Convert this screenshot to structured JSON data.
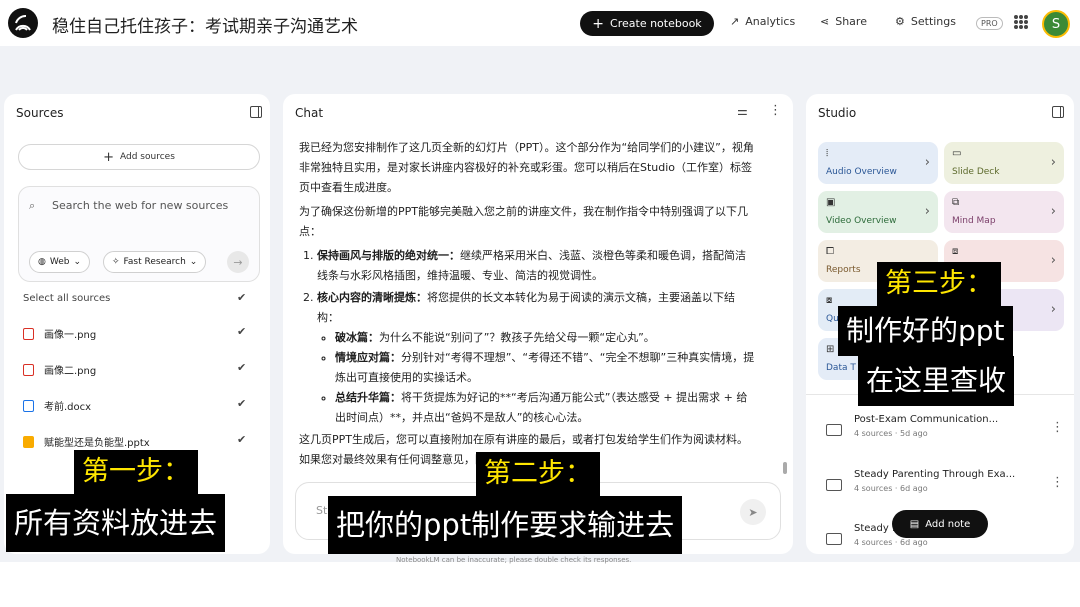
{
  "header": {
    "notebook_title": "稳住自己托住孩子：考试期亲子沟通艺术",
    "create_notebook": "Create notebook",
    "analytics": "Analytics",
    "share": "Share",
    "settings": "Settings",
    "pro": "PRO",
    "avatar_letter": "S"
  },
  "sources": {
    "title": "Sources",
    "add_sources": "Add sources",
    "search_placeholder": "Search the web for new sources",
    "web_chip": "Web",
    "research_chip": "Fast Research",
    "select_all": "Select all sources",
    "items": [
      {
        "name": "画像一.png",
        "icon": "image-icon",
        "color": "#d93025"
      },
      {
        "name": "画像二.png",
        "icon": "image-icon",
        "color": "#d93025"
      },
      {
        "name": "考前.docx",
        "icon": "doc-icon",
        "color": "#1a73e8"
      },
      {
        "name": "赋能型还是负能型.pptx",
        "icon": "slides-icon",
        "color": "#f9ab00"
      }
    ]
  },
  "chat": {
    "title": "Chat",
    "p1": "我已经为您安排制作了这几页全新的幻灯片（PPT）。这个部分作为“给同学们的小建议”，视角非常独特且实用，是对家长讲座内容极好的补充或彩蛋。您可以稍后在Studio（工作室）标签页中查看生成进度。",
    "p2": "为了确保这份新增的PPT能够完美融入您之前的讲座文件，我在制作指令中特别强调了以下几点：",
    "li1_bold": "保持画风与排版的绝对统一：",
    "li1_text": "继续严格采用米白、浅蓝、淡橙色等柔和暖色调，搭配简洁线条与水彩风格插图，维持温暖、专业、简洁的视觉调性。",
    "li2_bold": "核心内容的清晰提炼：",
    "li2_text": "将您提供的长文本转化为易于阅读的演示文稿，主要涵盖以下结构：",
    "sub1_bold": "破冰篇：",
    "sub1_text": "为什么不能说“别问了”？教孩子先给父母一颗“定心丸”。",
    "sub2_bold": "情境应对篇：",
    "sub2_text": "分别针对“考得不理想”、“考得还不错”、“完全不想聊”三种真实情境，提炼出可直接使用的实操话术。",
    "sub3_bold": "总结升华篇：",
    "sub3_text": "将干货提炼为好记的**“考后沟通万能公式”（表达感受 + 提出需求 + 给出时间点）**，并点出“爸妈不是敌人”的核心心法。",
    "p3": "这几页PPT生成后，您可以直接附加在原有讲座的最后，或者打包发给学生们作为阅读材料。如果您对最终效果有任何调整意见，随时告诉我！",
    "input_placeholder": "St",
    "disclaimer": "NotebookLM can be inaccurate; please double check its responses."
  },
  "studio": {
    "title": "Studio",
    "tiles": [
      {
        "label": "Audio Overview",
        "icon": "audio-icon",
        "bg": "#e4ecf7",
        "color": "#2b5796"
      },
      {
        "label": "Slide Deck",
        "icon": "slides-icon",
        "bg": "#eef0df",
        "color": "#5d6a2c"
      },
      {
        "label": "Video Overview",
        "icon": "video-icon",
        "bg": "#e2f0e4",
        "color": "#2d6b3a"
      },
      {
        "label": "Mind Map",
        "icon": "mindmap-icon",
        "bg": "#f3e6ef",
        "color": "#7b3f6a"
      },
      {
        "label": "Reports",
        "icon": "report-icon",
        "bg": "#f3ede3",
        "color": "#7a5a2f"
      },
      {
        "label": "",
        "icon": "flashcards-icon",
        "bg": "#f6e3e3",
        "color": "#8a3a3a"
      },
      {
        "label": "Qu",
        "icon": "quiz-icon",
        "bg": "#e3ecf6",
        "color": "#2b5796"
      },
      {
        "label": "",
        "icon": "infographic-icon",
        "bg": "#ece6f4",
        "color": "#5b3f88"
      },
      {
        "label": "Data T",
        "icon": "table-icon",
        "bg": "#e4ecf7",
        "color": "#2b5796"
      }
    ],
    "notes": [
      {
        "title": "Post-Exam Communication...",
        "meta": "4 sources · 5d ago"
      },
      {
        "title": "Steady Parenting Through Exa...",
        "meta": "4 sources · 6d ago"
      },
      {
        "title": "Steady ... Exa...",
        "meta": "4 sources · 6d ago"
      }
    ],
    "add_note": "Add note"
  },
  "overlays": {
    "step1_title": "第一步：",
    "step1_text": "所有资料放进去",
    "step2_title": "第二步：",
    "step2_text": "把你的ppt制作要求输进去",
    "step3_title": "第三步：",
    "step3_line1": "制作好的ppt",
    "step3_line2": "在这里查收"
  }
}
